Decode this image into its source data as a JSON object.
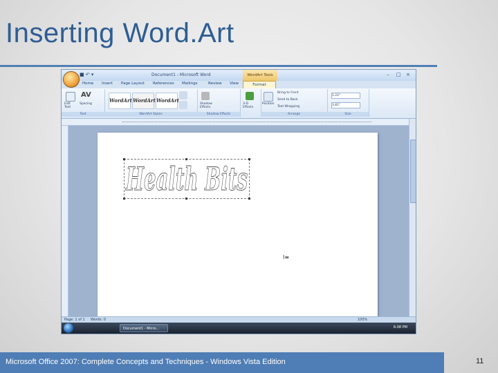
{
  "slide": {
    "title": "Inserting Word.Art",
    "footer": "Microsoft Office 2007: Complete Concepts and Techniques - Windows Vista Edition",
    "page_number": "11"
  },
  "word": {
    "title": "Document1 - Microsoft Word",
    "contextual_tab_group": "WordArt Tools",
    "tabs": [
      "Home",
      "Insert",
      "Page Layout",
      "References",
      "Mailings",
      "Review",
      "View"
    ],
    "active_tab": "Format",
    "ribbon": {
      "text_group": {
        "label": "Text",
        "edit_text": "Edit Text",
        "spacing": "Spacing"
      },
      "styles_group": {
        "label": "WordArt Styles",
        "thumbs": [
          "WordArt",
          "WordArt",
          "WordArt"
        ]
      },
      "shadow_group": {
        "label": "Shadow Effects",
        "button": "Shadow Effects"
      },
      "effects_3d": {
        "button": "3-D Effects"
      },
      "arrange_group": {
        "label": "Arrange",
        "position": "Position",
        "bring_to_front": "Bring to Front",
        "send_to_back": "Send to Back",
        "text_wrapping": "Text Wrapping"
      },
      "size_group": {
        "label": "Size",
        "height": "1.22\"",
        "width": "3.81\""
      }
    },
    "document": {
      "wordart_text": "Health Bits"
    },
    "status": {
      "page": "Page: 1 of 1",
      "words": "Words: 0",
      "zoom": "100%"
    },
    "taskbar": {
      "task": "Document1 - Micro...",
      "clock": "6:08 PM"
    }
  },
  "colors": {
    "accent": "#4f7fb6",
    "title": "#2e5d93",
    "ribbon_active": "#fff6d6"
  }
}
